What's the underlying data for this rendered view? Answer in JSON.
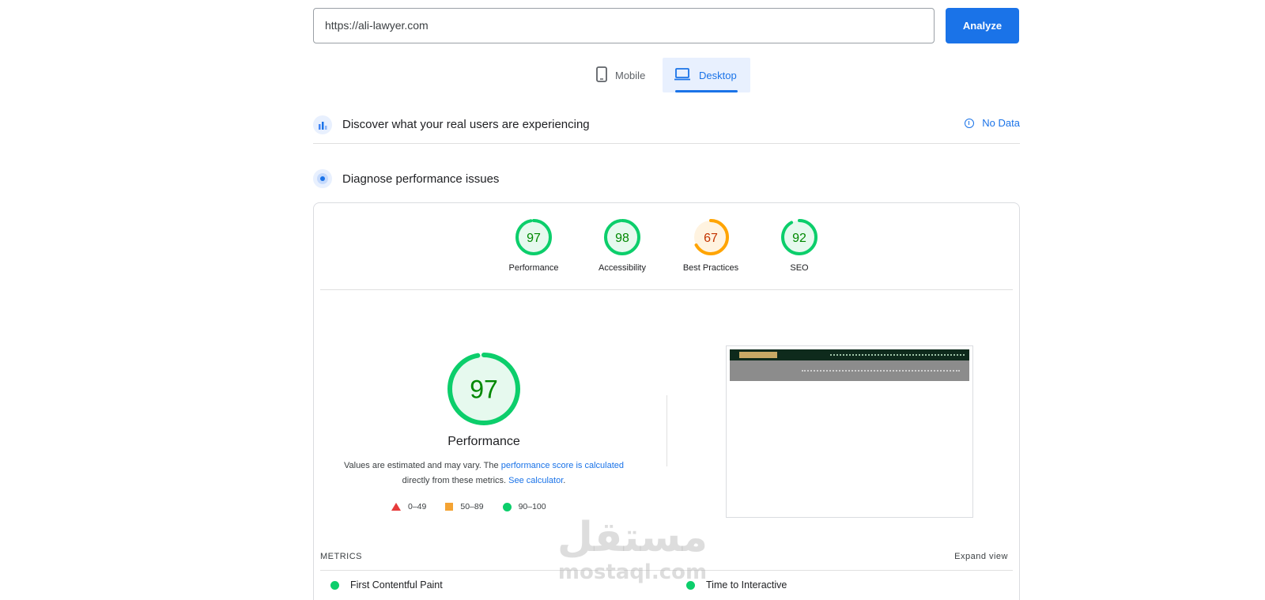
{
  "search": {
    "url_value": "https://ali-lawyer.com",
    "analyze_label": "Analyze"
  },
  "device_tabs": [
    {
      "label": "Mobile",
      "icon": "smartphone-icon",
      "active": false
    },
    {
      "label": "Desktop",
      "icon": "laptop-icon",
      "active": true
    }
  ],
  "sections": {
    "crux": {
      "title": "Discover what your real users are experiencing",
      "status": "No Data"
    },
    "diagnose": {
      "title": "Diagnose performance issues"
    }
  },
  "scores": [
    {
      "value": "97",
      "label": "Performance",
      "color": "#0cce6b",
      "text_color": "#008800",
      "bg": "#e6f9ee",
      "fraction": 0.97
    },
    {
      "value": "98",
      "label": "Accessibility",
      "color": "#0cce6b",
      "text_color": "#008800",
      "bg": "#e6f9ee",
      "fraction": 0.98
    },
    {
      "value": "67",
      "label": "Best Practices",
      "color": "#ffa400",
      "text_color": "#c33300",
      "bg": "#fff3e0",
      "fraction": 0.67
    },
    {
      "value": "92",
      "label": "SEO",
      "color": "#0cce6b",
      "text_color": "#008800",
      "bg": "#e6f9ee",
      "fraction": 0.92
    }
  ],
  "performance": {
    "score": "97",
    "fraction": 0.97,
    "title": "Performance",
    "desc_before": "Values are estimated and may vary. The ",
    "desc_link1": "performance score is calculated",
    "desc_middle": " directly from these metrics. ",
    "desc_link2": "See calculator",
    "desc_after": "."
  },
  "legend": [
    {
      "shape": "triangle",
      "range": "0–49",
      "color": "#e63b3b"
    },
    {
      "shape": "square",
      "range": "50–89",
      "color": "#f4a333"
    },
    {
      "shape": "circle",
      "range": "90–100",
      "color": "#0cce6b"
    }
  ],
  "metrics": {
    "heading": "METRICS",
    "expand_label": "Expand view",
    "items": [
      {
        "name": "First Contentful Paint",
        "status_color": "#0cce6b"
      },
      {
        "name": "Time to Interactive",
        "status_color": "#0cce6b"
      }
    ]
  },
  "watermark": {
    "arabic": "مستقل",
    "latin": "mostaql.com"
  }
}
